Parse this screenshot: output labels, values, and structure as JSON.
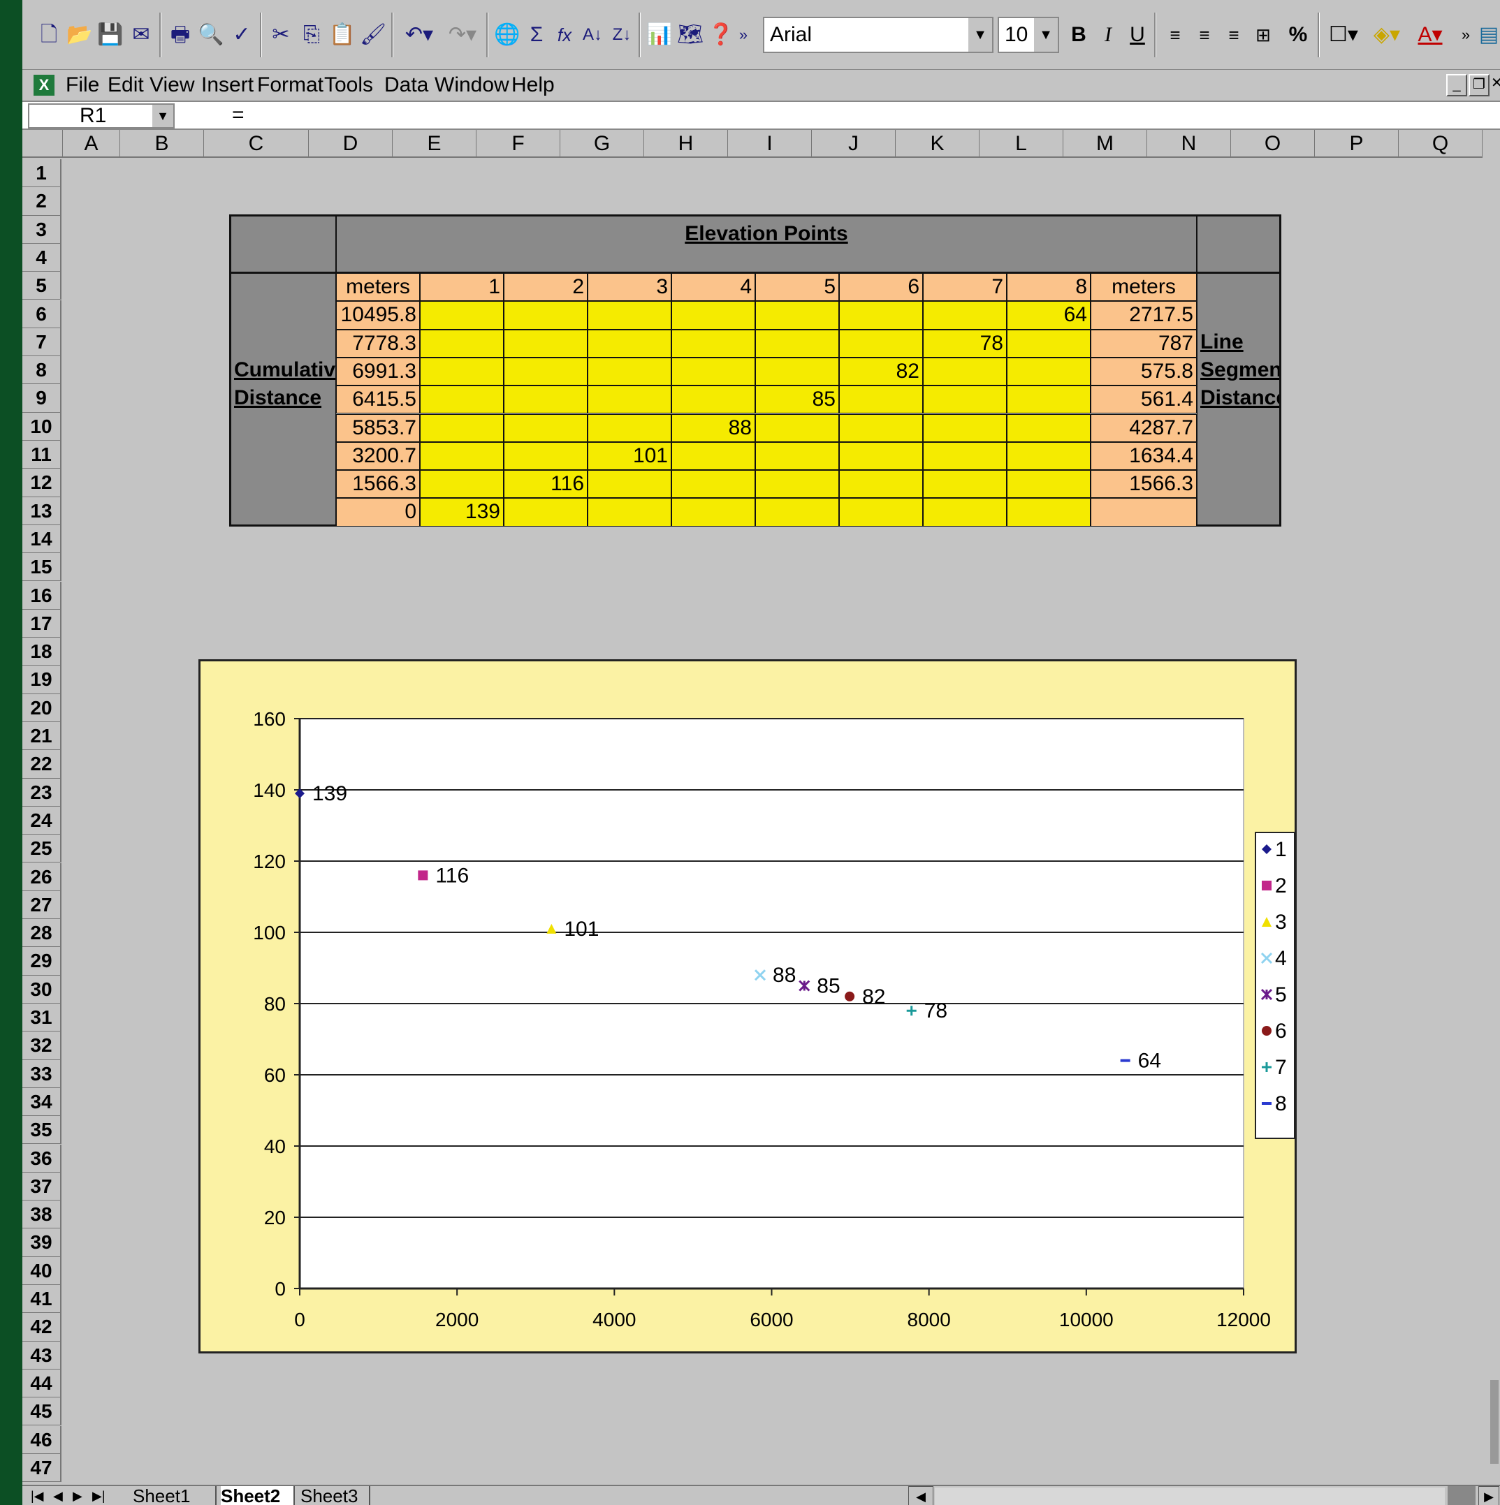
{
  "toolbar": {
    "font_name": "Arial",
    "font_size": "10",
    "bold": "B",
    "italic": "I",
    "underline": "U",
    "percent": "%",
    "sum": "Σ",
    "fx": "fx"
  },
  "menu": [
    "File",
    "Edit",
    "View",
    "Insert",
    "Format",
    "Tools",
    "Data",
    "Window",
    "Help"
  ],
  "formula_bar": {
    "name_box": "R1",
    "equals": "="
  },
  "columns": [
    "A",
    "B",
    "C",
    "D",
    "E",
    "F",
    "G",
    "H",
    "I",
    "J",
    "K",
    "L",
    "M",
    "N",
    "O",
    "P",
    "Q"
  ],
  "rows": [
    "1",
    "2",
    "3",
    "4",
    "5",
    "6",
    "7",
    "8",
    "9",
    "10",
    "11",
    "12",
    "13",
    "14",
    "15",
    "16",
    "17",
    "18",
    "19",
    "20",
    "21",
    "22",
    "23",
    "24",
    "25",
    "26",
    "27",
    "28",
    "29",
    "30",
    "31",
    "32",
    "33",
    "34",
    "35",
    "36",
    "37",
    "38",
    "39",
    "40",
    "41",
    "42",
    "43",
    "44",
    "45",
    "46",
    "47"
  ],
  "table": {
    "header": "Elevation Points",
    "left_label_1": "Cumulative",
    "left_label_2": "Distance",
    "right_label_1": "Line",
    "right_label_2": "Segment",
    "right_label_3": "Distance",
    "unit_left": "meters",
    "unit_right": "meters",
    "point_headers": [
      "1",
      "2",
      "3",
      "4",
      "5",
      "6",
      "7",
      "8"
    ],
    "rows": [
      {
        "cumulative": "10495.8",
        "col": 8,
        "value": "64",
        "segment": "2717.5"
      },
      {
        "cumulative": "7778.3",
        "col": 7,
        "value": "78",
        "segment": "787"
      },
      {
        "cumulative": "6991.3",
        "col": 6,
        "value": "82",
        "segment": "575.8"
      },
      {
        "cumulative": "6415.5",
        "col": 5,
        "value": "85",
        "segment": "561.4"
      },
      {
        "cumulative": "5853.7",
        "col": 4,
        "value": "88",
        "segment": "4287.7"
      },
      {
        "cumulative": "3200.7",
        "col": 3,
        "value": "101",
        "segment": "1634.4"
      },
      {
        "cumulative": "1566.3",
        "col": 2,
        "value": "116",
        "segment": "1566.3"
      },
      {
        "cumulative": "0",
        "col": 1,
        "value": "139",
        "segment": ""
      }
    ]
  },
  "chart_data": {
    "type": "scatter",
    "xlim": [
      0,
      12000
    ],
    "ylim": [
      0,
      160
    ],
    "x_ticks": [
      "0",
      "2000",
      "4000",
      "6000",
      "8000",
      "10000",
      "12000"
    ],
    "y_ticks": [
      "0",
      "20",
      "40",
      "60",
      "80",
      "100",
      "120",
      "140",
      "160"
    ],
    "grid": "horizontal",
    "legend": "right",
    "series": [
      {
        "name": "1",
        "x": 0,
        "y": 139,
        "label": "139",
        "color": "#1a1a8c",
        "marker": "diamond"
      },
      {
        "name": "2",
        "x": 1566.3,
        "y": 116,
        "label": "116",
        "color": "#c2268a",
        "marker": "square"
      },
      {
        "name": "3",
        "x": 3200.7,
        "y": 101,
        "label": "101",
        "color": "#f0e000",
        "marker": "triangle"
      },
      {
        "name": "4",
        "x": 5853.7,
        "y": 88,
        "label": "88",
        "color": "#8fd3f0",
        "marker": "x"
      },
      {
        "name": "5",
        "x": 6415.5,
        "y": 85,
        "label": "85",
        "color": "#6a1a8a",
        "marker": "star"
      },
      {
        "name": "6",
        "x": 6991.3,
        "y": 82,
        "label": "82",
        "color": "#8a1a1a",
        "marker": "circle"
      },
      {
        "name": "7",
        "x": 7778.3,
        "y": 78,
        "label": "78",
        "color": "#1a9a9a",
        "marker": "plus"
      },
      {
        "name": "8",
        "x": 10495.8,
        "y": 64,
        "label": "64",
        "color": "#2a3ad0",
        "marker": "dash"
      }
    ]
  },
  "sheets": [
    "Sheet1",
    "Sheet2",
    "Sheet3"
  ],
  "active_sheet": "Sheet2"
}
